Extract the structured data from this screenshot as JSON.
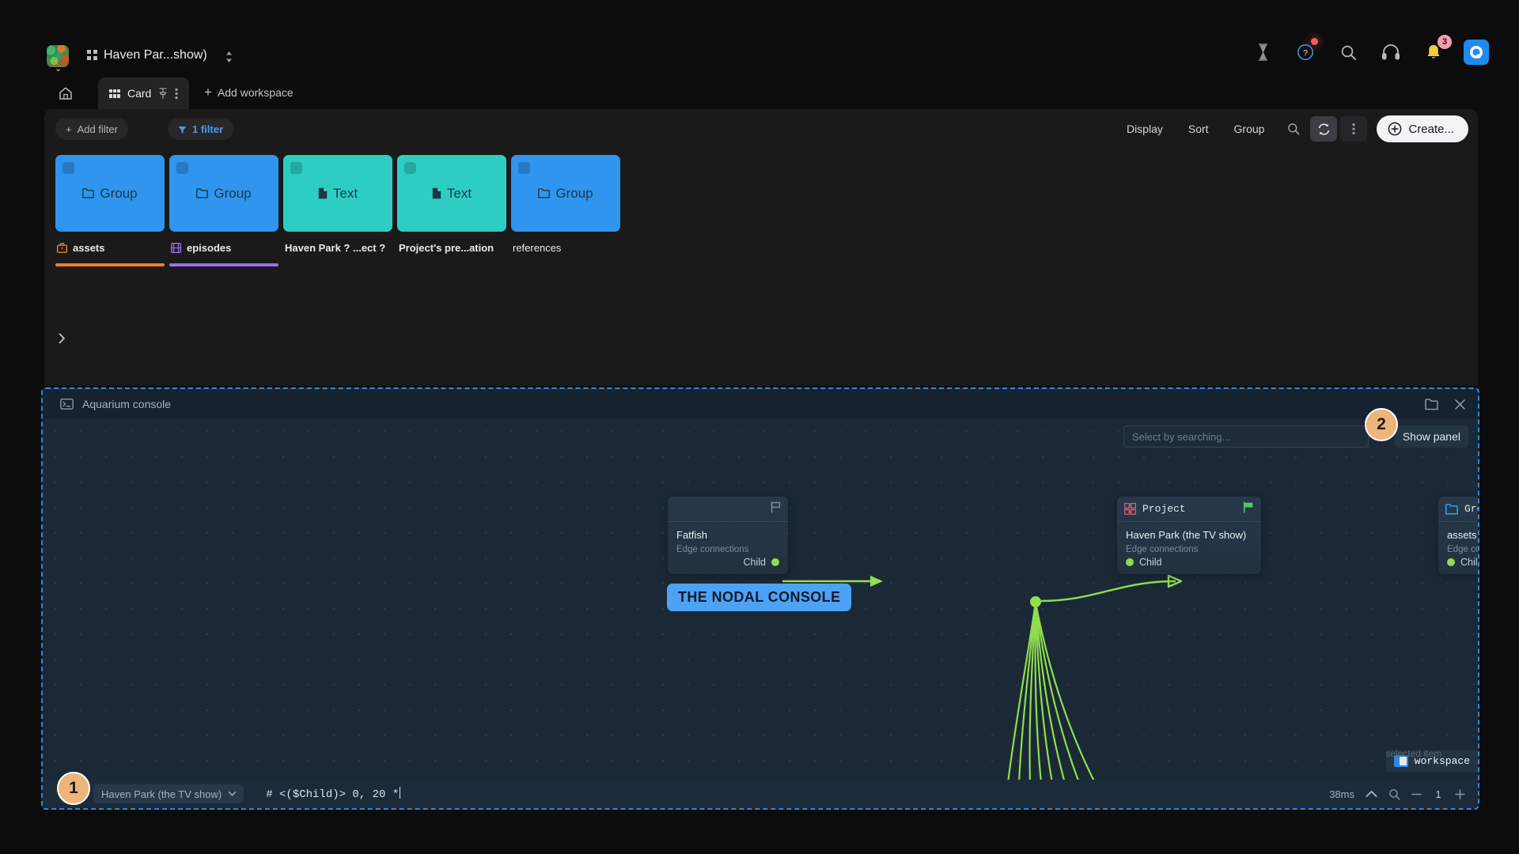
{
  "topbar": {
    "workspace_title": "Haven Par...show)",
    "icons": [
      {
        "name": "hourglass-icon"
      },
      {
        "name": "help-icon",
        "has_dot": true
      },
      {
        "name": "search-icon"
      },
      {
        "name": "headphones-icon"
      },
      {
        "name": "notifications-icon",
        "badge": "3"
      },
      {
        "name": "app-icon"
      }
    ]
  },
  "tabs": {
    "home_label": "",
    "active_tab": "Card",
    "add_workspace": "Add workspace"
  },
  "filters": {
    "add_filter": "Add filter",
    "active_filter": "1 filter"
  },
  "toolbar": {
    "display": "Display",
    "sort": "Sort",
    "group": "Group",
    "create": "Create..."
  },
  "cards": [
    {
      "type": "Group",
      "icon": "folder-icon",
      "title": "assets",
      "title_icon": "briefcase-icon",
      "thumb_color": "#2f95ee",
      "bar_color": "#f0801f",
      "bold": true
    },
    {
      "type": "Group",
      "icon": "folder-icon",
      "title": "episodes",
      "title_icon": "film-icon",
      "thumb_color": "#2f95ee",
      "bar_color": "#9b6cf2",
      "bold": true
    },
    {
      "type": "Text",
      "icon": "file-icon",
      "title": "Haven Park ? ...ect ?",
      "title_icon": "",
      "thumb_color": "#2ecdc4",
      "bar_color": "transparent",
      "bold": true
    },
    {
      "type": "Text",
      "icon": "file-icon",
      "title": "Project's pre...ation",
      "title_icon": "",
      "thumb_color": "#2ecdc4",
      "bar_color": "transparent",
      "bold": true
    },
    {
      "type": "Group",
      "icon": "folder-icon",
      "title": "references",
      "title_icon": "",
      "thumb_color": "#2f95ee",
      "bar_color": "transparent",
      "bold": false
    }
  ],
  "console": {
    "title": "Aquarium console",
    "search_placeholder": "Select by searching...",
    "show_panel": "Show panel",
    "overlay_title": "THE NODAL CONSOLE",
    "nodes": [
      {
        "header": "",
        "header_icon": "flag-outline-icon",
        "name": "Fatfish",
        "sub": "Edge connections",
        "port_out": "Child"
      },
      {
        "header": "Project",
        "header_icon": "project-grid-icon",
        "flag": "flag-green-icon",
        "name": "Haven Park (the TV show)",
        "sub": "Edge connections",
        "port_in": "Child",
        "port_out": "Child"
      },
      {
        "header": "Group",
        "header_icon": "folder-icon",
        "name": "assets",
        "sub": "Edge connections",
        "port_in": "Child"
      }
    ],
    "workspace_badge": "workspace",
    "workspace_badge_sub": "selected item",
    "command": {
      "context": "Haven Park (the TV show)",
      "text": "# <($Child)> 0, 20 *",
      "timing": "38ms",
      "zoom_level": "1"
    }
  },
  "annotations": [
    {
      "label": "1"
    },
    {
      "label": "2"
    }
  ],
  "colors": {
    "accent_blue": "#4a9bf5",
    "panel_border": "#2f87d8",
    "edge_green": "#8ede4f",
    "orange_bar": "#f0801f",
    "purple_bar": "#9b6cf2"
  }
}
